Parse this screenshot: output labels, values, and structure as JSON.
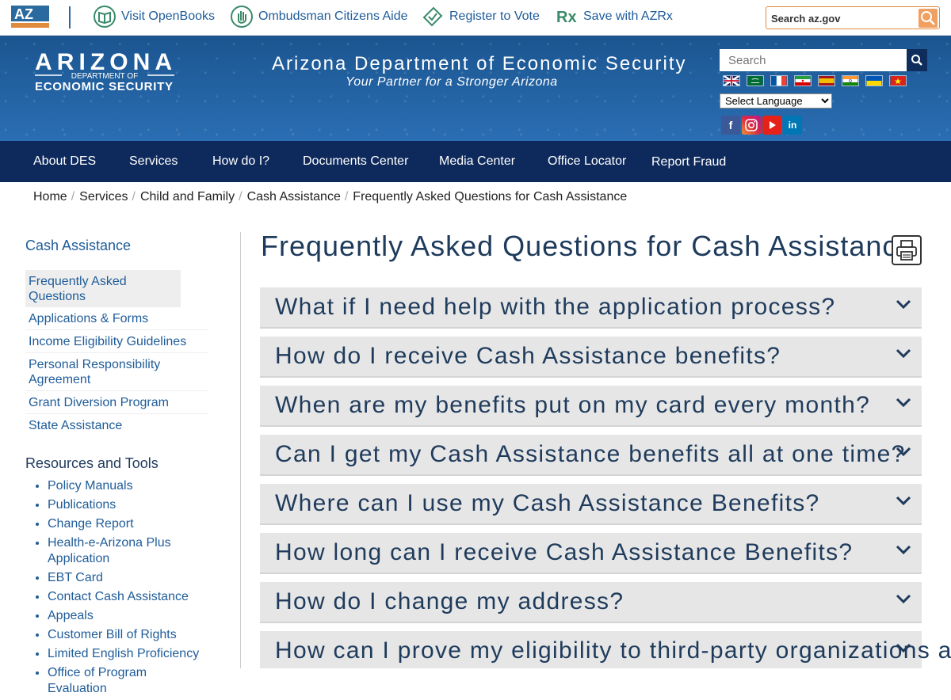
{
  "topbar": {
    "links": [
      {
        "label": "Visit OpenBooks",
        "icon": "book-icon"
      },
      {
        "label": "Ombudsman Citizens Aide",
        "icon": "hand-icon"
      },
      {
        "label": "Register to Vote",
        "icon": "ballot-icon"
      },
      {
        "label": "Save with AZRx",
        "icon": "prescription-icon"
      }
    ],
    "search_placeholder": "Search az.gov"
  },
  "header": {
    "logo": {
      "big": "ARIZONA",
      "small1": "DEPARTMENT OF",
      "small2": "ECONOMIC SECURITY"
    },
    "title": "Arizona Department of Economic Security",
    "subtitle": "Your Partner for a Stronger Arizona",
    "search_placeholder": "Search",
    "language_select": "Select Language",
    "flags": [
      "uk",
      "saudi",
      "france",
      "iran",
      "spain",
      "india",
      "ukraine",
      "vietnam"
    ]
  },
  "nav": {
    "items": [
      "About DES",
      "Services",
      "How do I?",
      "Documents Center",
      "Media Center",
      "Office Locator",
      "Report Fraud"
    ]
  },
  "breadcrumb": [
    "Home",
    "Services",
    "Child and Family",
    "Cash Assistance",
    "Frequently Asked Questions for Cash Assistance"
  ],
  "sidebar": {
    "heading": "Cash Assistance",
    "items": [
      "Frequently Asked Questions",
      "Applications & Forms",
      "Income Eligibility Guidelines",
      "Personal Responsibility Agreement",
      "Grant Diversion Program",
      "State Assistance"
    ],
    "resources_heading": "Resources and Tools",
    "resources": [
      "Policy Manuals",
      "Publications",
      "Change Report",
      "Health-e-Arizona Plus Application",
      "EBT Card",
      "Contact Cash Assistance",
      "Appeals",
      "Customer Bill of Rights",
      "Limited English Proficiency",
      "Office of Program Evaluation"
    ]
  },
  "main": {
    "title": "Frequently Asked Questions for Cash Assistance",
    "faqs": [
      "What if I need help with the application process?",
      "How do I receive Cash Assistance benefits?",
      "When are my benefits put on my card every month?",
      "Can I get my Cash Assistance benefits all at one time?",
      "Where can I use my Cash Assistance Benefits?",
      "How long can I receive Cash Assistance Benefits?",
      "How do I change my address?",
      "How can I prove my eligibility to third-party organizations and"
    ]
  },
  "colors": {
    "nav_bg": "#0e2a5c",
    "header_bg": "#1b5590",
    "link": "#1f5c99",
    "heading": "#1f3b5c",
    "faq_bg": "#e6e6e6"
  }
}
